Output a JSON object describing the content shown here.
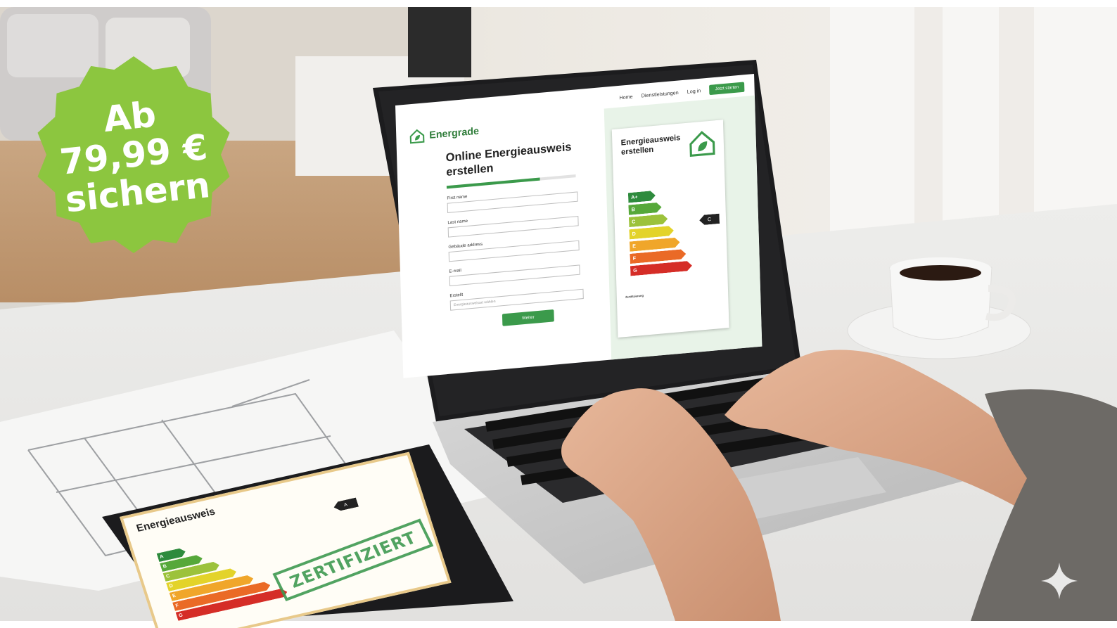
{
  "badge": {
    "line1": "Ab",
    "line2": "79,99 €",
    "line3": "sichern",
    "color": "#8cc63f"
  },
  "laptop_screen": {
    "logo": "Energrade",
    "nav": [
      "Home",
      "Dienstleistungen",
      "Log in"
    ],
    "nav_cta": "Jetzt starten",
    "form_title": "Online Energieausweis erstellen",
    "progress_fraction": 0.72,
    "fields": [
      {
        "label": "First name"
      },
      {
        "label": "Last name"
      },
      {
        "label": "Gebäude address"
      },
      {
        "label": "E-mail"
      },
      {
        "label": "Erstellt",
        "placeholder": "Energieausweisart wählen"
      }
    ],
    "submit": "Weiter",
    "card": {
      "title": "Energieausweis erstellen",
      "classes": [
        "A+",
        "B",
        "C",
        "D",
        "E",
        "F",
        "G"
      ],
      "indicator": "C",
      "footer": "Zertifizierung"
    },
    "accent_color": "#3b9a4b"
  },
  "tablet": {
    "title": "Energieausweis",
    "classes": [
      "A",
      "B",
      "C",
      "D",
      "E",
      "F",
      "G"
    ],
    "indicator": "A",
    "stamp": "ZERTIFIZIERT"
  },
  "rating_colors": [
    "#2e8b3d",
    "#56a83a",
    "#9cc23b",
    "#e3d32a",
    "#f0a62a",
    "#ea6a26",
    "#d52d27"
  ]
}
